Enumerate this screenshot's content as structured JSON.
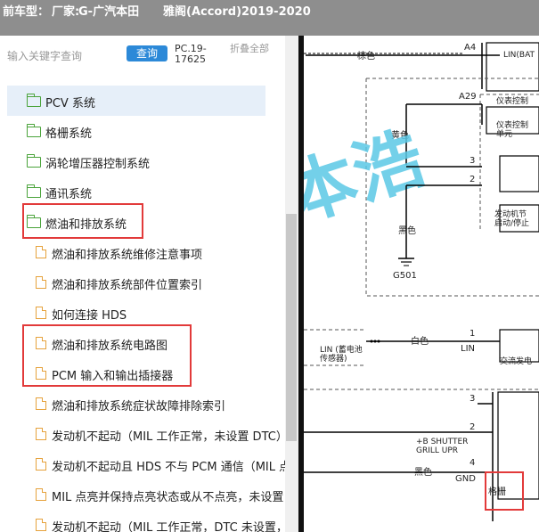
{
  "header": {
    "label": "前车型：",
    "vendor": "厂家:",
    "brand": "G-广汽本田",
    "model": "雅阁(Accord)2019-2020"
  },
  "search": {
    "placeholder": "输入关键字查询",
    "query_label": "查询",
    "code": "PC.19-17625",
    "collapse_label": "折叠全部"
  },
  "tree": {
    "items": [
      {
        "label": "PCV 系统",
        "type": "folder",
        "level": 1,
        "selected": true
      },
      {
        "label": "格栅系统",
        "type": "folder",
        "level": 1
      },
      {
        "label": "涡轮增压器控制系统",
        "type": "folder",
        "level": 1
      },
      {
        "label": "通讯系统",
        "type": "folder",
        "level": 1
      },
      {
        "label": "燃油和排放系统",
        "type": "folder",
        "level": 1,
        "highlighted": true
      },
      {
        "label": "燃油和排放系统维修注意事项",
        "type": "doc",
        "level": 2
      },
      {
        "label": "燃油和排放系统部件位置索引",
        "type": "doc",
        "level": 2
      },
      {
        "label": "如何连接 HDS",
        "type": "doc",
        "level": 2
      },
      {
        "label": "燃油和排放系统电路图",
        "type": "doc",
        "level": 2,
        "highlighted": true
      },
      {
        "label": "PCM 输入和输出插接器",
        "type": "doc",
        "level": 2,
        "highlighted": true
      },
      {
        "label": "燃油和排放系统症状故障排除索引",
        "type": "doc",
        "level": 2
      },
      {
        "label": "发动机不起动（MIL 工作正常，未设置 DTC）",
        "type": "doc",
        "level": 2
      },
      {
        "label": "发动机不起动且 HDS 不与 PCM 通信（MIL 点",
        "type": "doc",
        "level": 2
      },
      {
        "label": "MIL 点亮并保持点亮状态或从不点亮，未设置",
        "type": "doc",
        "level": 2
      },
      {
        "label": "发动机不起动（MIL 工作正常，DTC 未设置，",
        "type": "doc",
        "level": 2
      }
    ]
  },
  "diagram": {
    "watermark": "本浩",
    "labels": {
      "brown": "棕色",
      "a4": "A4",
      "lin_bat": "LIN(BAT",
      "a29": "A29",
      "yellow": "黄色",
      "gauge_line1": "仪表控制",
      "gauge_line2": "单元",
      "pin3a": "3",
      "pin2a": "2",
      "ign_line1": "发动机节",
      "ign_line2": "启动/停止",
      "black": "黑色",
      "g501": "G501",
      "lin_sensor_line1": "LIN (蓄电池",
      "lin_sensor_line2": "传感器)",
      "white": "白色",
      "pin1": "1",
      "lin": "LIN",
      "alternator": "交流发电",
      "pin3b": "3",
      "pin2b": "2",
      "shutter_line1": "+B SHUTTER",
      "shutter_line2": "GRILL UPR",
      "pin4": "4",
      "black2": "黑色",
      "gnd": "GND",
      "grille": "格栅"
    }
  },
  "colors": {
    "titlebar": "#8e8e8e",
    "query_button": "#2c89d8",
    "highlight_box": "#e23a3a",
    "selected_row": "#e6eff9",
    "folder_icon": "#4aa33a",
    "doc_icon": "#e6a23c",
    "watermark": "#5bc8e6"
  }
}
